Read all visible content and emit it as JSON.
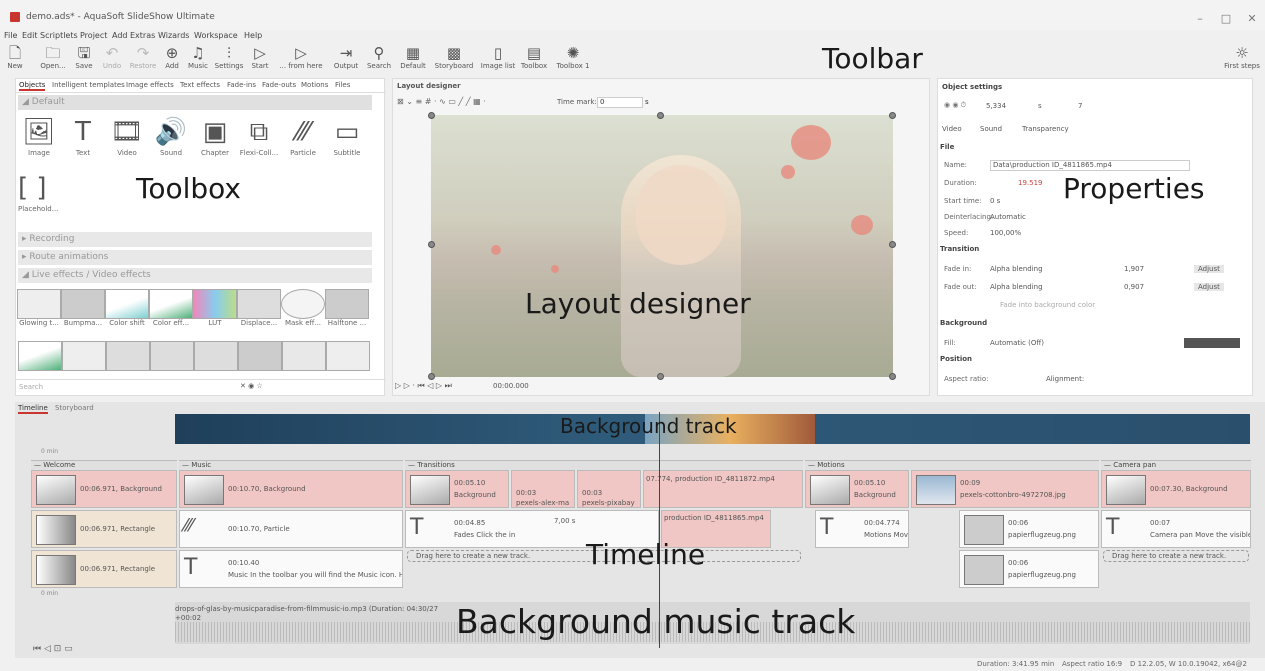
{
  "window": {
    "title": "demo.ads* - AquaSoft SlideShow Ultimate"
  },
  "menu": [
    "File",
    "Edit",
    "Scriptlets",
    "Project",
    "Add",
    "Extras",
    "Wizards",
    "Workspace",
    "Help"
  ],
  "toolbar": {
    "buttons": [
      {
        "label": "New",
        "icon": "new-icon"
      },
      {
        "label": "Open...",
        "icon": "open-icon"
      },
      {
        "label": "Save",
        "icon": "save-icon"
      },
      {
        "label": "Undo",
        "icon": "undo-icon"
      },
      {
        "label": "Restore",
        "icon": "redo-icon"
      },
      {
        "label": "Add",
        "icon": "add-icon"
      },
      {
        "label": "Music",
        "icon": "music-icon"
      },
      {
        "label": "Settings",
        "icon": "settings-icon"
      },
      {
        "label": "Start",
        "icon": "play-icon"
      },
      {
        "label": "... from here",
        "icon": "play-from-here-icon"
      },
      {
        "label": "Output",
        "icon": "output-icon"
      },
      {
        "label": "Search",
        "icon": "search-icon"
      },
      {
        "label": "Default",
        "icon": "layout-default-icon"
      },
      {
        "label": "Storyboard",
        "icon": "storyboard-icon"
      },
      {
        "label": "Image list",
        "icon": "image-list-icon"
      },
      {
        "label": "Toolbox",
        "icon": "toolbox-icon"
      },
      {
        "label": "Toolbox 1",
        "icon": "toolbox1-icon"
      }
    ],
    "first_steps": "First steps"
  },
  "labels": {
    "toolbar": "Toolbar",
    "toolbox": "Toolbox",
    "layout": "Layout designer",
    "properties": "Properties",
    "timeline": "Timeline",
    "bgtrack": "Background track",
    "bgmusic": "Background music track"
  },
  "toolbox": {
    "tabs": [
      "Objects",
      "Intelligent templates",
      "Image effects",
      "Text effects",
      "Fade-ins",
      "Fade-outs",
      "Motions",
      "Files"
    ],
    "default_section": "Default",
    "objects": [
      "Image",
      "Text",
      "Video",
      "Sound",
      "Chapter",
      "Flexi-Coll...",
      "Particle",
      "Subtitle"
    ],
    "placeholder": "Placehold...",
    "sections": [
      "Recording",
      "Route animations",
      "Live effects / Video effects"
    ],
    "effects": [
      "Glowing t...",
      "Bumpma...",
      "Color shift",
      "Color eff...",
      "LUT",
      "Displace...",
      "Mask eff...",
      "Halftone ..."
    ],
    "search_placeholder": "Search"
  },
  "layout_designer": {
    "title": "Layout designer",
    "time_mark_label": "Time mark:",
    "time_mark_value": "0",
    "time_unit": "s",
    "playback_time": "00:00.000"
  },
  "properties": {
    "title": "Object settings",
    "duration_top": "5,334",
    "unit": "s",
    "count": "7",
    "tabs": [
      "Video",
      "Sound",
      "Transparency"
    ],
    "file_header": "File",
    "name_label": "Name:",
    "name_value": "Data\\production ID_4811865.mp4",
    "duration_label": "Duration:",
    "duration_value": "19.519",
    "start_label": "Start time:",
    "start_value": "0 s",
    "deint_label": "Deinterlacing:",
    "deint_value": "Automatic",
    "speed_label": "Speed:",
    "speed_value": "100,00%",
    "transition_header": "Transition",
    "fadein_label": "Fade in:",
    "fadein_value": "Alpha blending",
    "fadein_time": "1,907",
    "fadeout_label": "Fade out:",
    "fadeout_value": "Alpha blending",
    "fadeout_time": "0,907",
    "adjust": "Adjust",
    "fade_bg": "Fade into background color",
    "background_header": "Background",
    "fill_label": "Fill:",
    "fill_value": "Automatic (Off)",
    "position_header": "Position",
    "aspect_label": "Aspect ratio:",
    "alignment_label": "Alignment:"
  },
  "timeline": {
    "tabs": [
      "Timeline",
      "Storyboard"
    ],
    "ruler_start": "0 min",
    "groups": [
      {
        "name": "Welcome"
      },
      {
        "name": "Music"
      },
      {
        "name": "Transitions"
      },
      {
        "name": "Motions"
      },
      {
        "name": "Camera pan"
      }
    ],
    "clips": {
      "welcome_bg": "00:06.971, Background",
      "welcome_rect1": "00:06.971, Rectangle",
      "welcome_rect2": "00:06.971, Rectangle",
      "music_bg": "00:10.70, Background",
      "music_particle": "00:10.70, Particle",
      "music_text_time": "00:10.40",
      "music_text": "Music In the toolbar you will find the Music icon. H",
      "trans_bg_time": "00:05.10",
      "trans_bg": "Background",
      "trans_small1": "00:03",
      "trans_small1b": "pexels-alex-ma",
      "trans_small2": "00:03",
      "trans_small2b": "pexels-pixabay",
      "trans_video": "07.774, production ID_4811872.mp4",
      "trans_text_time": "00:04.85",
      "trans_text": "Fades Click the in",
      "trans_gap": "7,00 s",
      "trans_video2": "production ID_4811865.mp4",
      "drag_hint": "Drag here to create a new track.",
      "motions_bg_time": "00:05.10",
      "motions_bg": "Background",
      "motions_img_time": "00:09",
      "motions_img": "pexels-cottonbro-4972708.jpg",
      "motions_text_time": "00:04.774",
      "motions_text": "Motions Move to",
      "paper1_time": "00:06",
      "paper1": "papierflugzeug.png",
      "paper2_time": "00:06",
      "paper2": "papierflugzeug.png",
      "cam_bg": "00:07.30, Background",
      "cam_text_time": "00:07",
      "cam_text": "Camera pan Move the visible",
      "cam_drag": "Drag here to create a new track."
    },
    "music_ruler": "0 min",
    "music_file": "drops-of-glas-by-musicparadise-from-filmmusic-io.mp3 (Duration: 04:30/27",
    "music_offset": "+00:02"
  },
  "status": {
    "duration": "Duration: 3:41.95 min",
    "aspect": "Aspect ratio 16:9",
    "version": "D 12.2.05, W 10.0.19042, x64@2"
  }
}
